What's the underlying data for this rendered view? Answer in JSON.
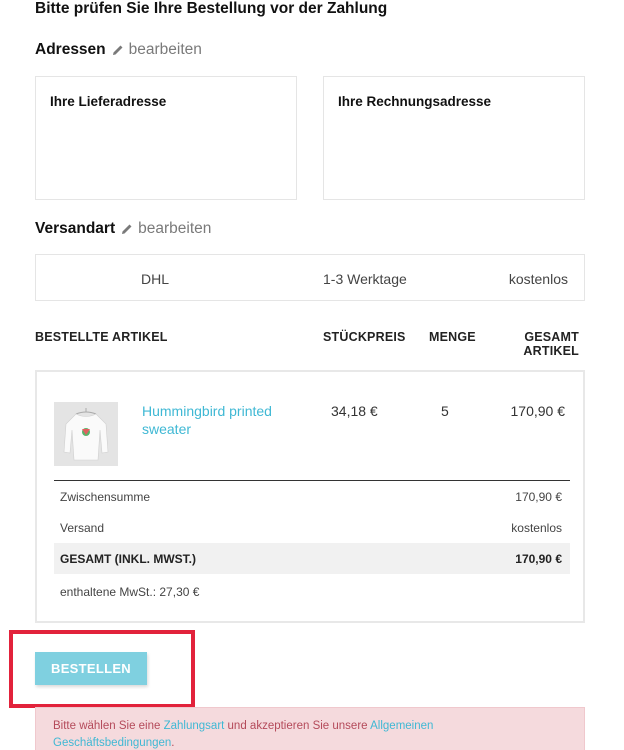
{
  "page": {
    "title": "Bitte prüfen Sie Ihre Bestellung vor der Zahlung"
  },
  "addresses": {
    "heading": "Adressen",
    "edit_label": "bearbeiten",
    "delivery_title": "Ihre Lieferadresse",
    "billing_title": "Ihre Rechnungsadresse"
  },
  "shipping": {
    "heading": "Versandart",
    "edit_label": "bearbeiten",
    "carrier": "DHL",
    "delivery_time": "1-3 Werktage",
    "price": "kostenlos"
  },
  "items": {
    "headers": {
      "article": "BESTELLTE ARTIKEL",
      "unit_price": "STÜCKPREIS",
      "quantity": "MENGE",
      "total_line1": "GESAMT",
      "total_line2": "ARTIKEL"
    },
    "rows": [
      {
        "name_line1": "Hummingbird printed",
        "name_line2": "sweater",
        "unit_price": "34,18 €",
        "quantity": "5",
        "total": "170,90 €"
      }
    ]
  },
  "summary": {
    "subtotal_label": "Zwischensumme",
    "subtotal_value": "170,90 €",
    "shipping_label": "Versand",
    "shipping_value": "kostenlos",
    "total_label": "GESAMT (INKL. MWST.)",
    "total_value": "170,90 €",
    "vat_text": "enthaltene MwSt.: 27,30 €"
  },
  "order_button": {
    "label": "BESTELLEN"
  },
  "alert": {
    "text_before": "Bitte wählen Sie eine ",
    "payment_link": "Zahlungsart",
    "text_middle": " und akzeptieren Sie unsere ",
    "terms_link_line1": "Allgemeinen",
    "terms_link_line2": "Geschäftsbedingungen",
    "text_after": "."
  },
  "colors": {
    "accent": "#3fb8d4",
    "button": "#7fd0e0",
    "highlight": "#e2223b",
    "alert_bg": "#f5dadd"
  }
}
